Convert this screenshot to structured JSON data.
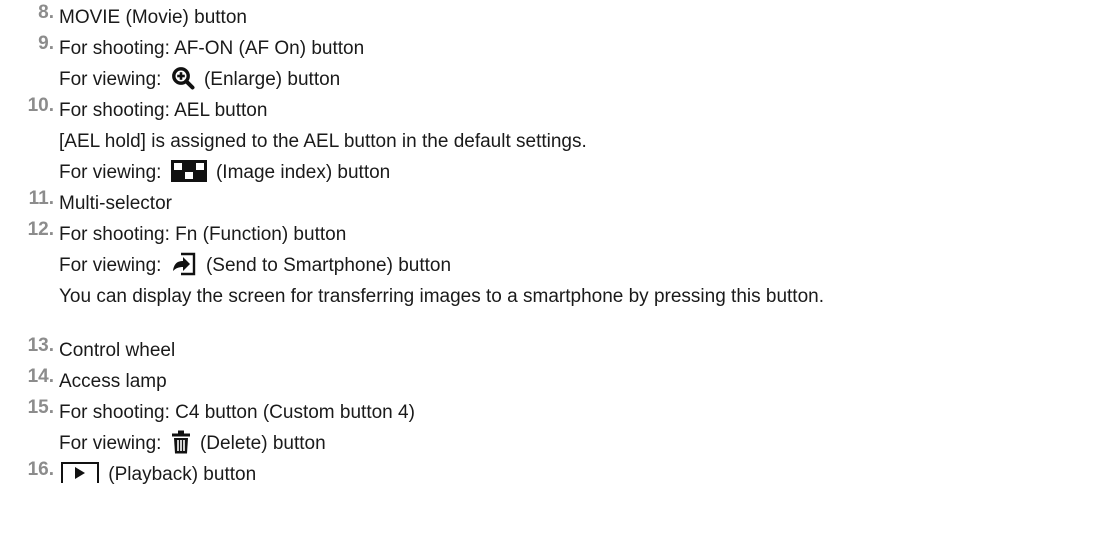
{
  "items": [
    {
      "number": "8.",
      "lines": [
        "MOVIE (Movie) button"
      ]
    },
    {
      "number": "9.",
      "lines": [
        "For shooting: AF-ON (AF On) button"
      ],
      "viewing": {
        "prefix": "For viewing:",
        "icon": "zoom-in-icon",
        "suffix": "(Enlarge) button"
      }
    },
    {
      "number": "10.",
      "lines": [
        "For shooting: AEL button",
        "[AEL hold] is assigned to the AEL button in the default settings."
      ],
      "viewing": {
        "prefix": "For viewing:",
        "icon": "image-index-icon",
        "suffix": "(Image index) button"
      }
    },
    {
      "number": "11.",
      "lines": [
        "Multi-selector"
      ]
    },
    {
      "number": "12.",
      "lines": [
        "For shooting: Fn (Function) button"
      ],
      "viewing": {
        "prefix": "For viewing:",
        "icon": "send-to-smartphone-icon",
        "suffix": "(Send to Smartphone) button"
      },
      "note": "You can display the screen for transferring images to a smartphone by pressing this button."
    },
    {
      "number": "13.",
      "lines": [
        "Control wheel"
      ]
    },
    {
      "number": "14.",
      "lines": [
        "Access lamp"
      ]
    },
    {
      "number": "15.",
      "lines": [
        "For shooting: C4 button (Custom button 4)"
      ],
      "viewing": {
        "prefix": "For viewing:",
        "icon": "trash-icon",
        "suffix": "(Delete) button"
      }
    },
    {
      "number": "16.",
      "playback": {
        "icon": "playback-icon",
        "suffix": "(Playback) button"
      }
    }
  ]
}
